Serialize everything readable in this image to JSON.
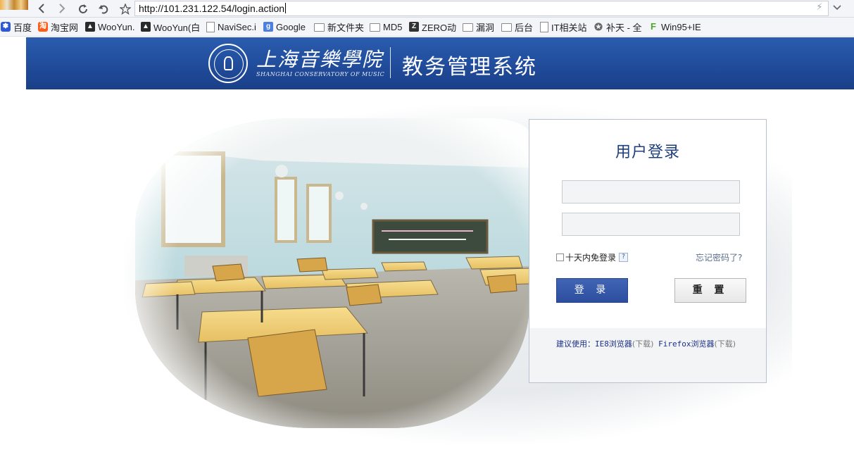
{
  "browser": {
    "url": "http://101.231.122.54/login.action",
    "bookmarks": [
      {
        "label": "百度",
        "icon": "paw-icon"
      },
      {
        "label": "淘宝网",
        "icon": "taobao-icon"
      },
      {
        "label": "WooYun.",
        "icon": "wooyun-icon"
      },
      {
        "label": "WooYun(白",
        "icon": "wooyun-icon"
      },
      {
        "label": "NaviSec.i",
        "icon": "page-icon"
      },
      {
        "label": "Google",
        "icon": "google-icon"
      },
      {
        "label": "新文件夹",
        "icon": "folder-icon"
      },
      {
        "label": "MD5",
        "icon": "folder-icon"
      },
      {
        "label": "ZERO动",
        "icon": "zero-icon"
      },
      {
        "label": "漏洞",
        "icon": "folder-icon"
      },
      {
        "label": "后台",
        "icon": "folder-icon"
      },
      {
        "label": "IT相关站",
        "icon": "page-icon"
      },
      {
        "label": "补天 - 全",
        "icon": "star-icon"
      },
      {
        "label": "Win95+IE",
        "icon": "f-icon"
      }
    ]
  },
  "header": {
    "school_name_cn": "上海音樂學院",
    "school_name_en": "SHANGHAI CONSERVATORY OF MUSIC",
    "system_title": "教务管理系统"
  },
  "login": {
    "title": "用户登录",
    "username_value": "",
    "password_value": "",
    "remember_label": "十天内免登录",
    "help_label": "?",
    "forgot_label": "忘记密码了?",
    "login_button": "登 录",
    "reset_button": "重 置",
    "suggest_prefix": "建议使用：",
    "ie_label": "IE8浏览器",
    "download_1": "(下载)",
    "firefox_label": "Firefox浏览器",
    "download_2": "(下载)"
  },
  "colors": {
    "banner": "#224f9f",
    "login_button": "#3458a8",
    "title_text": "#1f3f7c"
  }
}
